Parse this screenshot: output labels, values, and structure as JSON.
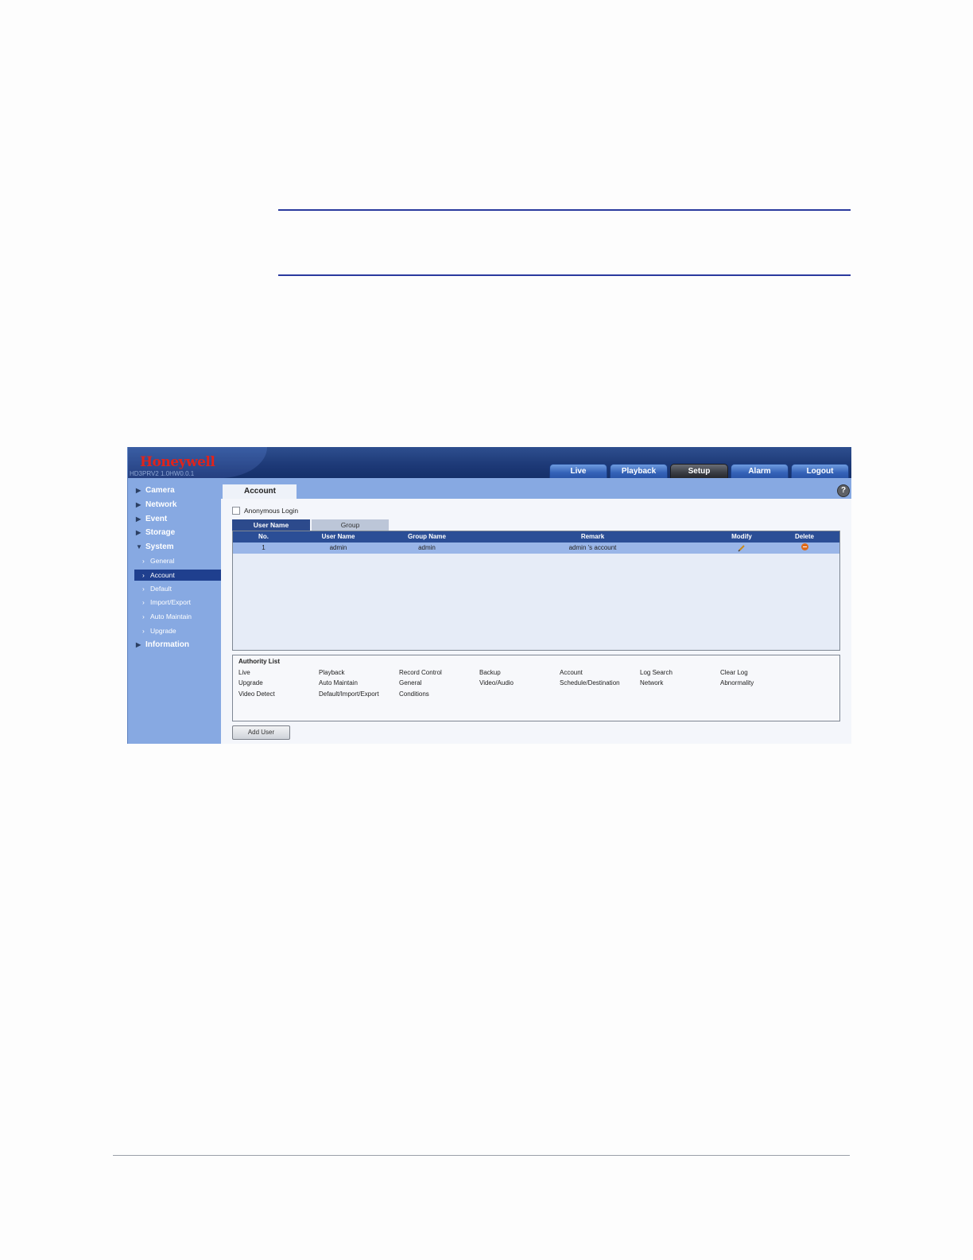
{
  "brand": {
    "logo": "Honeywell",
    "model": "HD3PRV2  1.0HW0.0.1"
  },
  "top_tabs": [
    {
      "label": "Live",
      "active": false
    },
    {
      "label": "Playback",
      "active": false
    },
    {
      "label": "Setup",
      "active": true
    },
    {
      "label": "Alarm",
      "active": false
    },
    {
      "label": "Logout",
      "active": false
    }
  ],
  "sidebar": {
    "sections": [
      "Camera",
      "Network",
      "Event",
      "Storage",
      "System",
      "Information"
    ],
    "system_items": [
      "General",
      "Account",
      "Default",
      "Import/Export",
      "Auto Maintain",
      "Upgrade"
    ],
    "selected": "Account"
  },
  "page": {
    "title": "Account",
    "help": "?"
  },
  "anonymous_login": {
    "label": "Anonymous Login",
    "checked": false
  },
  "subtabs": [
    "User Name",
    "Group"
  ],
  "table": {
    "headers": [
      "No.",
      "User Name",
      "Group Name",
      "Remark",
      "Modify",
      "Delete"
    ],
    "rows": [
      {
        "no": "1",
        "user": "admin",
        "group": "admin",
        "remark": "admin 's account"
      }
    ]
  },
  "authority": {
    "title": "Authority List",
    "rows": [
      [
        "Live",
        "Playback",
        "Record Control",
        "Backup",
        "Account",
        "Log Search",
        "Clear Log"
      ],
      [
        "Upgrade",
        "Auto Maintain",
        "General",
        "Video/Audio",
        "Schedule/Destination",
        "Network",
        "Abnormality"
      ],
      [
        "Video Detect",
        "Default/Import/Export",
        "Conditions"
      ]
    ]
  },
  "add_user_label": "Add User",
  "colors": {
    "brand_red": "#e0231b",
    "header_blue": "#1e3a78",
    "sidebar_blue": "#87a9e2",
    "active_tab": "#3a3d44"
  }
}
